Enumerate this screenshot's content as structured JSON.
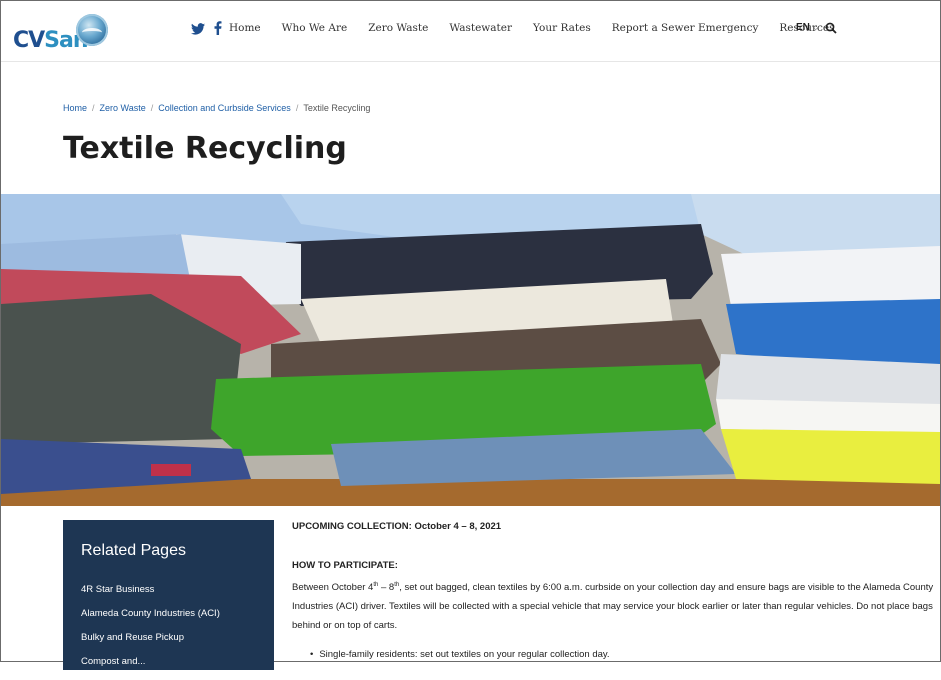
{
  "header": {
    "logo_text_cv": "CV",
    "logo_text_san": "San",
    "social": [
      "twitter-icon",
      "facebook-icon"
    ],
    "nav": [
      "Home",
      "Who We Are",
      "Zero Waste",
      "Wastewater",
      "Your Rates",
      "Report a Sewer Emergency",
      "Resources"
    ],
    "lang": "EN"
  },
  "breadcrumb": {
    "items": [
      "Home",
      "Zero Waste",
      "Collection and Curbside Services"
    ],
    "current": "Textile Recycling"
  },
  "page_title": "Textile Recycling",
  "sidebar": {
    "title": "Related Pages",
    "items": [
      "4R Star Business",
      "Alameda County Industries (ACI)",
      "Bulky and Reuse Pickup",
      "Compost and..."
    ]
  },
  "content": {
    "upcoming": "UPCOMING COLLECTION: October 4 – 8, 2021",
    "how_title": "HOW TO PARTICIPATE:",
    "para_prefix": "Between October 4",
    "para_sup1": "th",
    "para_mid": " – 8",
    "para_sup2": "th",
    "para_rest": ", set out bagged, clean textiles by 6:00 a.m. curbside on your collection day and ensure bags are visible to the Alameda County Industries (ACI) driver. Textiles will be collected with a special vehicle that may service your block earlier or later than regular vehicles. Do not place bags behind or on top of carts.",
    "bullet1": "Single-family residents: set out textiles on your regular collection day."
  },
  "colors": {
    "brand_navy": "#1e3653",
    "link_blue": "#1f5fa6"
  }
}
